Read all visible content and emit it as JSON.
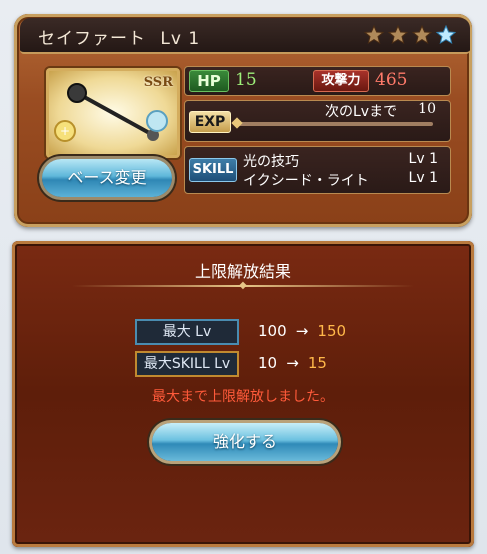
{
  "character": {
    "name": "セイファート",
    "level_label": "Lv 1",
    "rarity": "SSR",
    "stars_filled": 3,
    "stars_total": 4
  },
  "base_change_button": "ベース変更",
  "stats": {
    "hp_label": "HP",
    "hp_value": "15",
    "atk_label": "攻撃力",
    "atk_value": "465"
  },
  "exp": {
    "label": "EXP",
    "next_label": "次のLvまで",
    "next_value": "10",
    "progress": 0
  },
  "skill": {
    "label": "SKILL",
    "items": [
      {
        "name": "光の技巧",
        "level": "Lv 1"
      },
      {
        "name": "イクシード・ライト",
        "level": "Lv 1"
      }
    ]
  },
  "result": {
    "title": "上限解放結果",
    "max_lv_label": "最大 Lv",
    "max_lv_from": "100",
    "arrow": "→",
    "max_lv_to": "150",
    "max_skill_label": "最大SKILL Lv",
    "max_skill_from": "10",
    "max_skill_to": "15",
    "message": "最大まで上限解放しました。"
  },
  "enhance_button": "強化する",
  "colors": {
    "accent_blue": "#5fb7da",
    "upgrade_orange": "#ffb84a",
    "message_red": "#ff5a3a"
  }
}
